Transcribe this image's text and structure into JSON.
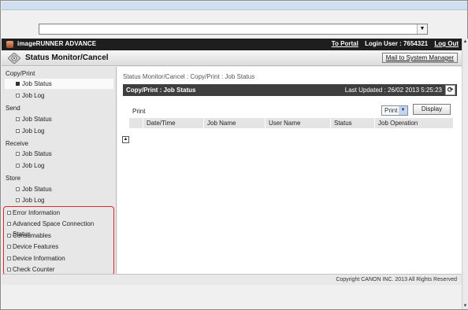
{
  "header": {
    "brand": "imageRUNNER ADVANCE",
    "to_portal": "To Portal",
    "login_user": "Login User : 7654321",
    "logout": "Log Out"
  },
  "titlebar": {
    "title": "Status Monitor/Cancel",
    "mail_button": "Mail to System Manager"
  },
  "sidebar": {
    "categories": [
      "Copy/Print",
      "Send",
      "Receive",
      "Store"
    ],
    "items": [
      "Job Status",
      "Job Log"
    ],
    "extra_items": [
      "Error Information",
      "Advanced Space Connection Status",
      "Consumables",
      "Device Features",
      "Device Information",
      "Check Counter"
    ]
  },
  "main": {
    "breadcrumb": "Status Monitor/Cancel : Copy/Print : Job Status",
    "section_title": "Copy/Print : Job Status",
    "last_updated": "Last Updated : 26/02 2013 5:25:23",
    "print_label": "Print",
    "print_select_value": "Print",
    "display_button": "Display",
    "columns": [
      "Date/Time",
      "Job Name",
      "User Name",
      "Status",
      "Job Operation"
    ]
  },
  "footer": {
    "copyright": "Copyright CANON INC. 2013 All Rights Reserved"
  },
  "colors": {
    "header_bg": "#1e1e1e",
    "section_bar_bg": "#3e3e3e",
    "highlight_border": "#e0262e",
    "sidebar_bg": "#e7e7e7"
  }
}
